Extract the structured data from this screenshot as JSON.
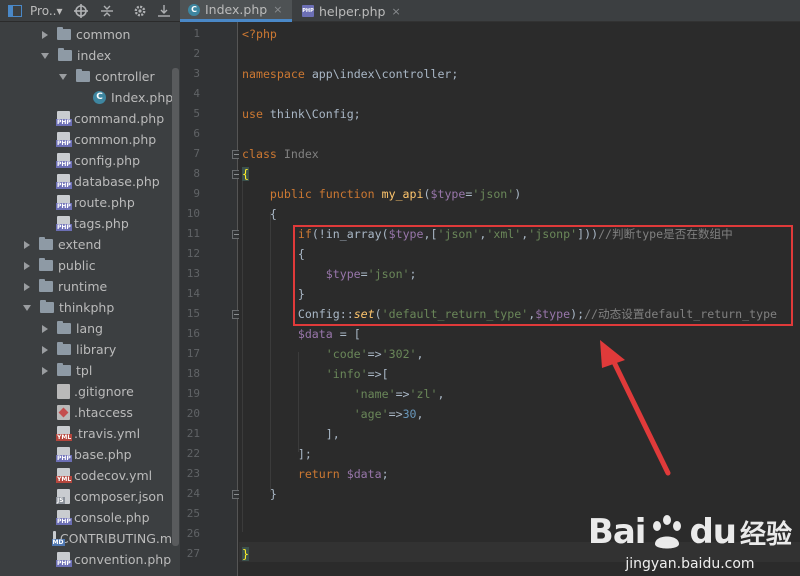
{
  "project_panel": {
    "title": "Pro..▾",
    "tree": [
      {
        "label": "common",
        "type": "folder",
        "depth": 2,
        "state": "collapsed"
      },
      {
        "label": "index",
        "type": "folder",
        "depth": 2,
        "state": "expanded"
      },
      {
        "label": "controller",
        "type": "folder",
        "depth": 3,
        "state": "expanded"
      },
      {
        "label": "Index.php",
        "type": "class",
        "depth": 4,
        "state": "none"
      },
      {
        "label": "command.php",
        "type": "php",
        "depth": 2,
        "state": "none"
      },
      {
        "label": "common.php",
        "type": "php",
        "depth": 2,
        "state": "none"
      },
      {
        "label": "config.php",
        "type": "php",
        "depth": 2,
        "state": "none"
      },
      {
        "label": "database.php",
        "type": "php",
        "depth": 2,
        "state": "none"
      },
      {
        "label": "route.php",
        "type": "php",
        "depth": 2,
        "state": "none"
      },
      {
        "label": "tags.php",
        "type": "php",
        "depth": 2,
        "state": "none"
      },
      {
        "label": "extend",
        "type": "folder",
        "depth": 1,
        "state": "collapsed"
      },
      {
        "label": "public",
        "type": "folder",
        "depth": 1,
        "state": "collapsed"
      },
      {
        "label": "runtime",
        "type": "folder",
        "depth": 1,
        "state": "collapsed"
      },
      {
        "label": "thinkphp",
        "type": "folder",
        "depth": 1,
        "state": "expanded"
      },
      {
        "label": "lang",
        "type": "folder",
        "depth": 2,
        "state": "collapsed"
      },
      {
        "label": "library",
        "type": "folder",
        "depth": 2,
        "state": "collapsed"
      },
      {
        "label": "tpl",
        "type": "folder",
        "depth": 2,
        "state": "collapsed"
      },
      {
        "label": ".gitignore",
        "type": "git",
        "depth": 2,
        "state": "none"
      },
      {
        "label": ".htaccess",
        "type": "ht",
        "depth": 2,
        "state": "none"
      },
      {
        "label": ".travis.yml",
        "type": "yml",
        "depth": 2,
        "state": "none"
      },
      {
        "label": "base.php",
        "type": "php",
        "depth": 2,
        "state": "none"
      },
      {
        "label": "codecov.yml",
        "type": "yml",
        "depth": 2,
        "state": "none"
      },
      {
        "label": "composer.json",
        "type": "json",
        "depth": 2,
        "state": "none"
      },
      {
        "label": "console.php",
        "type": "php",
        "depth": 2,
        "state": "none"
      },
      {
        "label": "CONTRIBUTING.md",
        "type": "md",
        "depth": 2,
        "state": "none"
      },
      {
        "label": "convention.php",
        "type": "php",
        "depth": 2,
        "state": "none"
      }
    ]
  },
  "tabs": [
    {
      "label": "Index.php",
      "close": "×",
      "active": true,
      "icon": "class-icon"
    },
    {
      "label": "helper.php",
      "close": "×",
      "active": false,
      "icon": "php-file-icon"
    }
  ],
  "editor": {
    "line_numbers": [
      "1",
      "2",
      "3",
      "4",
      "5",
      "6",
      "7",
      "8",
      "9",
      "10",
      "11",
      "12",
      "13",
      "14",
      "15",
      "16",
      "17",
      "18",
      "19",
      "20",
      "21",
      "22",
      "23",
      "24",
      "25",
      "26",
      "27"
    ],
    "current_line": 27,
    "lines": [
      [
        [
          "kw",
          "<?php"
        ]
      ],
      [],
      [
        [
          "kw",
          "namespace "
        ],
        [
          "plain",
          "app\\index\\controller;"
        ]
      ],
      [],
      [
        [
          "kw",
          "use "
        ],
        [
          "plain",
          "think\\Config;"
        ]
      ],
      [],
      [
        [
          "kw",
          "class "
        ],
        [
          "cmt",
          "Index"
        ]
      ],
      [
        [
          "brace",
          "{"
        ]
      ],
      [
        [
          "plain",
          "    "
        ],
        [
          "kw",
          "public function "
        ],
        [
          "fn",
          "my_api"
        ],
        [
          "plain",
          "("
        ],
        [
          "var",
          "$type"
        ],
        [
          "plain",
          "="
        ],
        [
          "str",
          "'json'"
        ],
        [
          "plain",
          ")"
        ]
      ],
      [
        [
          "plain",
          "    {"
        ]
      ],
      [
        [
          "plain",
          "        "
        ],
        [
          "kw",
          "if"
        ],
        [
          "plain",
          "(!"
        ],
        [
          "plain",
          "in_array("
        ],
        [
          "var",
          "$type"
        ],
        [
          "plain",
          ",["
        ],
        [
          "str",
          "'json'"
        ],
        [
          "plain",
          ","
        ],
        [
          "str",
          "'xml'"
        ],
        [
          "plain",
          ","
        ],
        [
          "str",
          "'jsonp'"
        ],
        [
          "plain",
          "]))"
        ],
        [
          "cmt",
          "//判断type是否在数组中"
        ]
      ],
      [
        [
          "plain",
          "        {"
        ]
      ],
      [
        [
          "plain",
          "            "
        ],
        [
          "var",
          "$type"
        ],
        [
          "plain",
          "="
        ],
        [
          "str",
          "'json'"
        ],
        [
          "plain",
          ";"
        ]
      ],
      [
        [
          "plain",
          "        }"
        ]
      ],
      [
        [
          "plain",
          "        Config::"
        ],
        [
          "ital",
          "set"
        ],
        [
          "plain",
          "("
        ],
        [
          "str",
          "'default_return_type'"
        ],
        [
          "plain",
          ","
        ],
        [
          "var",
          "$type"
        ],
        [
          "plain",
          ");"
        ],
        [
          "cmt",
          "//动态设置default_return_type"
        ]
      ],
      [
        [
          "plain",
          "        "
        ],
        [
          "var",
          "$data"
        ],
        [
          "plain",
          " = ["
        ]
      ],
      [
        [
          "plain",
          "            "
        ],
        [
          "str",
          "'code'"
        ],
        [
          "plain",
          "=>"
        ],
        [
          "str",
          "'302'"
        ],
        [
          "plain",
          ","
        ]
      ],
      [
        [
          "plain",
          "            "
        ],
        [
          "str",
          "'info'"
        ],
        [
          "plain",
          "=>["
        ]
      ],
      [
        [
          "plain",
          "                "
        ],
        [
          "str",
          "'name'"
        ],
        [
          "plain",
          "=>"
        ],
        [
          "str",
          "'zl'"
        ],
        [
          "plain",
          ","
        ]
      ],
      [
        [
          "plain",
          "                "
        ],
        [
          "str",
          "'age'"
        ],
        [
          "plain",
          "=>"
        ],
        [
          "num",
          "30"
        ],
        [
          "plain",
          ","
        ]
      ],
      [
        [
          "plain",
          "            ],"
        ]
      ],
      [
        [
          "plain",
          "        ];"
        ]
      ],
      [
        [
          "plain",
          "        "
        ],
        [
          "kw",
          "return "
        ],
        [
          "var",
          "$data"
        ],
        [
          "plain",
          ";"
        ]
      ],
      [
        [
          "plain",
          "    }"
        ]
      ],
      [],
      [],
      [
        [
          "brace",
          "}"
        ]
      ]
    ]
  },
  "colors": {
    "keyword": "#cc7832",
    "string": "#6a8759",
    "variable": "#9876aa",
    "function": "#ffc66d",
    "comment": "#808080",
    "annotation": "#e03a3a"
  },
  "watermark": {
    "brand_a": "Bai",
    "brand_b": "du",
    "brand_cn": "经验",
    "url": "jingyan.baidu.com"
  }
}
